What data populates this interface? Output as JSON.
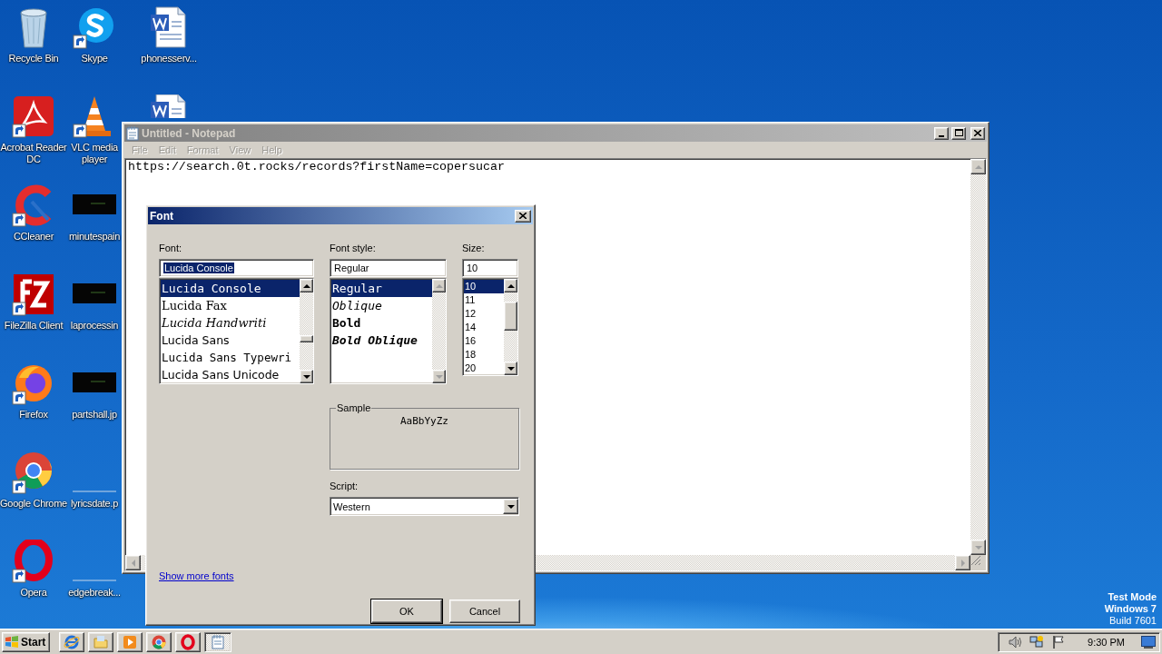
{
  "desktop": {
    "icons": [
      {
        "kind": "recycle",
        "label": "Recycle Bin"
      },
      {
        "kind": "acrobat",
        "label": "Acrobat Reader DC"
      },
      {
        "kind": "ccleaner",
        "label": "CCleaner"
      },
      {
        "kind": "filezilla",
        "label": "FileZilla Client"
      },
      {
        "kind": "firefox",
        "label": "Firefox"
      },
      {
        "kind": "chrome",
        "label": "Google Chrome"
      },
      {
        "kind": "opera",
        "label": "Opera"
      },
      {
        "kind": "skype",
        "label": "Skype"
      },
      {
        "kind": "vlc",
        "label": "VLC media player"
      },
      {
        "kind": "image",
        "label": "minutespain"
      },
      {
        "kind": "image",
        "label": "laprocessin"
      },
      {
        "kind": "image",
        "label": "partshall.jp"
      },
      {
        "kind": "blank",
        "label": "lyricsdate.p"
      },
      {
        "kind": "blank",
        "label": "edgebreak..."
      },
      {
        "kind": "word",
        "label": "phonesserv..."
      },
      {
        "kind": "word-partial"
      }
    ],
    "os_notice": [
      "Test Mode",
      "Windows 7",
      "Build 7601"
    ]
  },
  "notepad": {
    "title": "Untitled - Notepad",
    "active": false,
    "menu": [
      {
        "label": "File",
        "disabled": true
      },
      {
        "label": "Edit",
        "disabled": true
      },
      {
        "label": "Format",
        "disabled": true
      },
      {
        "label": "View",
        "disabled": true
      },
      {
        "label": "Help",
        "disabled": true
      }
    ],
    "text": "https://search.0t.rocks/records?firstName=copersucar"
  },
  "font_dialog": {
    "title": "Font",
    "font": {
      "label": "Font:",
      "value": "Lucida Console",
      "value_highlighted": true,
      "items": [
        {
          "name": "Lucida Console",
          "kind": "mono",
          "selected": true
        },
        {
          "name": "Lucida Fax",
          "kind": "serif",
          "selected": false
        },
        {
          "name": "Lucida Handwriti",
          "kind": "script",
          "selected": false
        },
        {
          "name": "Lucida Sans",
          "kind": "sans",
          "selected": false
        },
        {
          "name": "Lucida Sans Typewri",
          "kind": "typewriter",
          "selected": false
        },
        {
          "name": "Lucida Sans Unicode",
          "kind": "sans",
          "selected": false
        }
      ]
    },
    "font_style": {
      "label": "Font style:",
      "value": "Regular",
      "items": [
        {
          "name": "Regular",
          "kind": "regular",
          "selected": true
        },
        {
          "name": "Oblique",
          "kind": "oblique",
          "selected": false
        },
        {
          "name": "Bold",
          "kind": "bold",
          "selected": false
        },
        {
          "name": "Bold Oblique",
          "kind": "bold-oblique",
          "selected": false
        }
      ]
    },
    "size": {
      "label": "Size:",
      "value": "10",
      "items": [
        {
          "name": "10",
          "selected": true
        },
        {
          "name": "11",
          "selected": false
        },
        {
          "name": "12",
          "selected": false
        },
        {
          "name": "14",
          "selected": false
        },
        {
          "name": "16",
          "selected": false
        },
        {
          "name": "18",
          "selected": false
        },
        {
          "name": "20",
          "selected": false
        }
      ]
    },
    "sample": {
      "label": "Sample",
      "text": "AaBbYyZz"
    },
    "script": {
      "label": "Script:",
      "value": "Western"
    },
    "link": "Show more fonts",
    "buttons": [
      {
        "label": "OK",
        "default": true
      },
      {
        "label": "Cancel",
        "default": false
      }
    ]
  },
  "taskbar": {
    "start": "Start",
    "items": [
      {
        "kind": "ie",
        "selected": false
      },
      {
        "kind": "folder",
        "selected": false
      },
      {
        "kind": "media",
        "selected": false
      },
      {
        "kind": "chrome",
        "selected": false
      },
      {
        "kind": "opera",
        "selected": false
      },
      {
        "kind": "notepad",
        "selected": true
      }
    ],
    "clock": "9:30 PM"
  }
}
